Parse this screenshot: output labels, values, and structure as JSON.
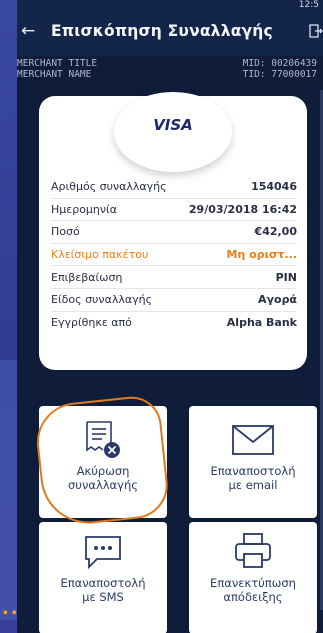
{
  "app": {
    "title": "Επισκόπηση Συναλλαγής",
    "status_time": "12:5"
  },
  "merchant": {
    "title": "MERCHANT TITLE",
    "name": "MERCHANT NAME",
    "mid": "MID: 00206439",
    "tid": "TID: 77000017"
  },
  "receipt": {
    "card_brand": "VISA",
    "rows": [
      {
        "label": "Αριθμός συναλλαγής",
        "value": "154046"
      },
      {
        "label": "Ημερομηνία",
        "value": "29/03/2018  16:42"
      },
      {
        "label": "Ποσό",
        "value": "€42,00"
      },
      {
        "label": "Κλείσιμο πακέτου",
        "value": "Μη οριστ..."
      },
      {
        "label": "Επιβεβαίωση",
        "value": "PIN"
      },
      {
        "label": "Είδος συναλλαγής",
        "value": "Αγορά"
      },
      {
        "label": "Εγγρίθηκε από",
        "value": "Alpha Bank"
      }
    ]
  },
  "actions": {
    "cancel": "Ακύρωση\nσυναλλαγής",
    "email": "Επαναποστολή\nμε email",
    "sms": "Επαναποστολή\nμε SMS",
    "reprint": "Επανεκτύπωση\nαπόδειξης"
  },
  "icons": {
    "back": "back-arrow-icon",
    "logout": "logout-icon",
    "cancel": "receipt-cancel-icon",
    "email": "envelope-icon",
    "sms": "chat-bubble-icon",
    "reprint": "printer-icon"
  },
  "colors": {
    "accent_orange": "#f07d1a",
    "navy": "#0f1d3a",
    "icon_blue": "#2a3a6a"
  }
}
